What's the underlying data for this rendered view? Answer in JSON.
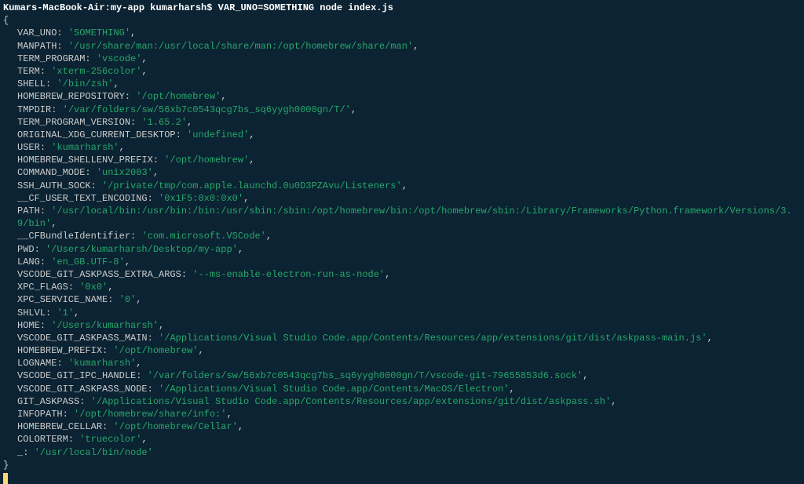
{
  "prompt": {
    "host": "Kumars-MacBook-Air",
    "folder": "my-app",
    "user": "kumarharsh",
    "command": "VAR_UNO=SOMETHING node index.js"
  },
  "output": {
    "open_brace": "{",
    "close_brace": "}",
    "entries": [
      {
        "key": "VAR_UNO",
        "value": "'SOMETHING'"
      },
      {
        "key": "MANPATH",
        "value": "'/usr/share/man:/usr/local/share/man:/opt/homebrew/share/man'"
      },
      {
        "key": "TERM_PROGRAM",
        "value": "'vscode'"
      },
      {
        "key": "TERM",
        "value": "'xterm-256color'"
      },
      {
        "key": "SHELL",
        "value": "'/bin/zsh'"
      },
      {
        "key": "HOMEBREW_REPOSITORY",
        "value": "'/opt/homebrew'"
      },
      {
        "key": "TMPDIR",
        "value": "'/var/folders/sw/56xb7c0543qcg7bs_sq6yygh0000gn/T/'"
      },
      {
        "key": "TERM_PROGRAM_VERSION",
        "value": "'1.65.2'"
      },
      {
        "key": "ORIGINAL_XDG_CURRENT_DESKTOP",
        "value": "'undefined'"
      },
      {
        "key": "USER",
        "value": "'kumarharsh'"
      },
      {
        "key": "HOMEBREW_SHELLENV_PREFIX",
        "value": "'/opt/homebrew'"
      },
      {
        "key": "COMMAND_MODE",
        "value": "'unix2003'"
      },
      {
        "key": "SSH_AUTH_SOCK",
        "value": "'/private/tmp/com.apple.launchd.0u0D3PZAvu/Listeners'"
      },
      {
        "key": "__CF_USER_TEXT_ENCODING",
        "value": "'0x1F5:0x0:0x0'"
      },
      {
        "key": "PATH",
        "value": "'/usr/local/bin:/usr/bin:/bin:/usr/sbin:/sbin:/opt/homebrew/bin:/opt/homebrew/sbin:/Library/Frameworks/Python.framework/Versions/3.9/bin'"
      },
      {
        "key": "__CFBundleIdentifier",
        "value": "'com.microsoft.VSCode'"
      },
      {
        "key": "PWD",
        "value": "'/Users/kumarharsh/Desktop/my-app'"
      },
      {
        "key": "LANG",
        "value": "'en_GB.UTF-8'"
      },
      {
        "key": "VSCODE_GIT_ASKPASS_EXTRA_ARGS",
        "value": "'--ms-enable-electron-run-as-node'"
      },
      {
        "key": "XPC_FLAGS",
        "value": "'0x0'"
      },
      {
        "key": "XPC_SERVICE_NAME",
        "value": "'0'"
      },
      {
        "key": "SHLVL",
        "value": "'1'"
      },
      {
        "key": "HOME",
        "value": "'/Users/kumarharsh'"
      },
      {
        "key": "VSCODE_GIT_ASKPASS_MAIN",
        "value": "'/Applications/Visual Studio Code.app/Contents/Resources/app/extensions/git/dist/askpass-main.js'"
      },
      {
        "key": "HOMEBREW_PREFIX",
        "value": "'/opt/homebrew'"
      },
      {
        "key": "LOGNAME",
        "value": "'kumarharsh'"
      },
      {
        "key": "VSCODE_GIT_IPC_HANDLE",
        "value": "'/var/folders/sw/56xb7c0543qcg7bs_sq6yygh0000gn/T/vscode-git-79655853d6.sock'"
      },
      {
        "key": "VSCODE_GIT_ASKPASS_NODE",
        "value": "'/Applications/Visual Studio Code.app/Contents/MacOS/Electron'"
      },
      {
        "key": "GIT_ASKPASS",
        "value": "'/Applications/Visual Studio Code.app/Contents/Resources/app/extensions/git/dist/askpass.sh'"
      },
      {
        "key": "INFOPATH",
        "value": "'/opt/homebrew/share/info:'"
      },
      {
        "key": "HOMEBREW_CELLAR",
        "value": "'/opt/homebrew/Cellar'"
      },
      {
        "key": "COLORTERM",
        "value": "'truecolor'"
      },
      {
        "key": "_",
        "value": "'/usr/local/bin/node'",
        "last": true
      }
    ]
  }
}
